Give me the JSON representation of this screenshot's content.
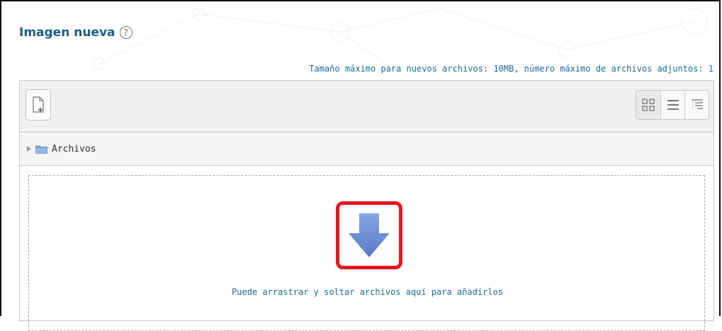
{
  "title": "Imagen nueva",
  "help_icon": "question-circle-icon",
  "limits_text": "Tamaño máximo para nuevos archivos: 10MB, número máximo de archivos adjuntos: 1",
  "toolbar": {
    "add_file_icon": "add-file-icon",
    "views": [
      {
        "name": "icons-view",
        "icon": "grid-icon",
        "active": true
      },
      {
        "name": "list-view",
        "icon": "list-icon",
        "active": false
      },
      {
        "name": "tree-view",
        "icon": "tree-icon",
        "active": false
      }
    ]
  },
  "path": {
    "folder_label": "Archivos"
  },
  "dropzone": {
    "icon": "download-arrow-icon",
    "text": "Puede arrastrar y soltar archivos aquí para añadirlos"
  },
  "colors": {
    "title": "#1b5e84",
    "link_text": "#1b6c96",
    "highlight": "#e8141c",
    "arrow": "#6d8fd6"
  }
}
